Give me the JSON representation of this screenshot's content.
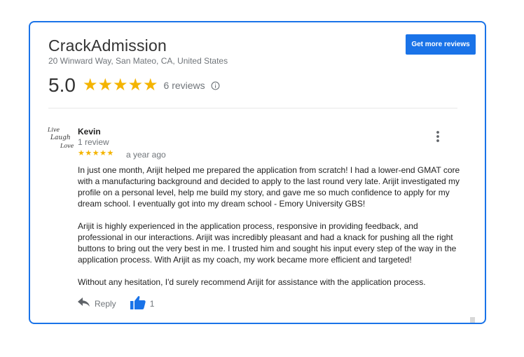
{
  "business": {
    "name": "CrackAdmission",
    "address": "20 Winward Way, San Mateo, CA, United States",
    "cta_label": "Get more reviews"
  },
  "summary": {
    "rating": "5.0",
    "stars": "★★★★★",
    "review_count": "6 reviews",
    "info_icon": "info-icon"
  },
  "review": {
    "avatar_lines": [
      "Live",
      "Laugh",
      "Love"
    ],
    "reviewer_name": "Kevin",
    "reviewer_meta": "1 review",
    "stars": "★★★★★",
    "age": "a year ago",
    "menu_icon": "more-vert-icon",
    "paragraphs": [
      "In just one month, Arijit helped me prepared the application from scratch! I had a lower-end GMAT core with a manufacturing background and decided to apply to the last round very late. Arijit investigated my profile on a personal level, help me build my story, and gave me so much confidence to apply for my dream school. I eventually got into my dream school - Emory University GBS!",
      "Arijit is highly experienced in the application process, responsive in providing feedback, and professional in our interactions. Arijit was incredibly pleasant and had a knack for pushing all the right buttons to bring out the very best in me. I trusted him and sought his input every step of the way in the application process. With Arijit as my coach, my work became more efficient and targeted!",
      "Without any hesitation, I'd surely recommend Arijit for assistance with the application process."
    ],
    "reply_label": "Reply",
    "like_count": "1"
  },
  "colors": {
    "accent": "#1a73e8",
    "star": "#f4b400",
    "muted_text": "#70757a"
  }
}
